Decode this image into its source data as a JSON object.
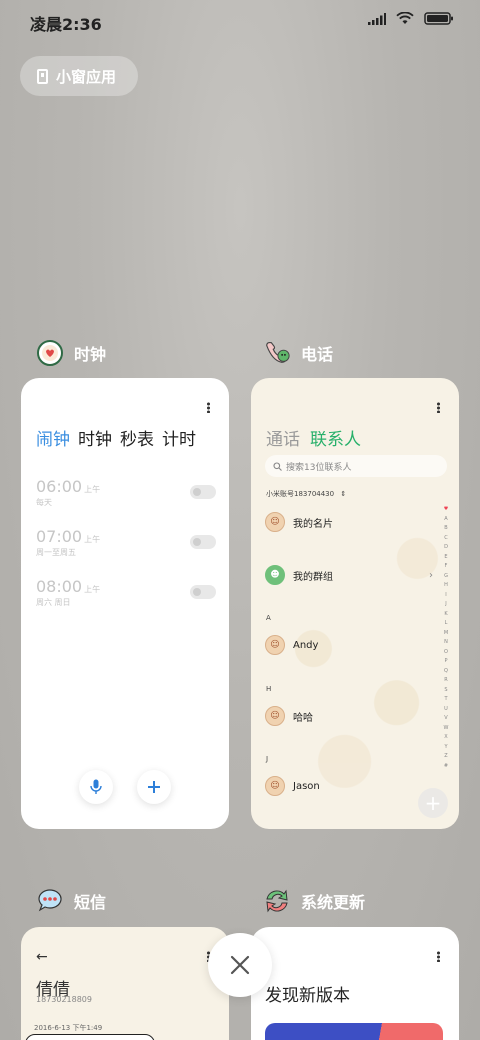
{
  "status_bar": {
    "time": "凌晨2:36"
  },
  "small_window": {
    "label": "小窗应用"
  },
  "apps": {
    "clock": {
      "name": "时钟",
      "tabs": [
        "闹钟",
        "时钟",
        "秒表",
        "计时"
      ],
      "active_tab": 0,
      "alarms": [
        {
          "time": "06:00",
          "ampm": "上午",
          "days": "每天",
          "enabled": false
        },
        {
          "time": "07:00",
          "ampm": "上午",
          "days": "周一至周五",
          "enabled": false
        },
        {
          "time": "08:00",
          "ampm": "上午",
          "days": "周六 周日",
          "enabled": false
        }
      ]
    },
    "phone": {
      "name": "电话",
      "tabs": [
        "通话",
        "联系人"
      ],
      "active_tab": 1,
      "search_placeholder": "搜索13位联系人",
      "account": "小米账号183704430",
      "my_card": "我的名片",
      "my_groups": "我的群组",
      "sections": [
        {
          "letter": "A",
          "contact": "Andy"
        },
        {
          "letter": "H",
          "contact": "哈哈"
        },
        {
          "letter": "J",
          "contact": "Jason"
        }
      ],
      "index_letters": [
        "A",
        "B",
        "C",
        "D",
        "E",
        "F",
        "G",
        "H",
        "I",
        "J",
        "K",
        "L",
        "M",
        "N",
        "O",
        "P",
        "Q",
        "R",
        "S",
        "T",
        "U",
        "V",
        "W",
        "X",
        "Y",
        "Z",
        "#"
      ]
    },
    "sms": {
      "name": "短信",
      "contact_name": "倩倩",
      "contact_number": "18730218809",
      "date": "2016-6-13 下午1:49"
    },
    "update": {
      "name": "系统更新",
      "title": "发现新版本"
    }
  },
  "colors": {
    "clock_active_tab": "#3a8ee0",
    "phone_active_tab": "#27b06a",
    "fab_icon": "#2d7fd9"
  },
  "icons": {
    "mic": "mic-icon",
    "add": "plus-icon",
    "close": "close-icon"
  }
}
